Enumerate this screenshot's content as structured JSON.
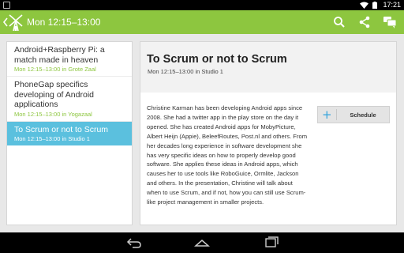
{
  "status_bar": {
    "time": "17:21"
  },
  "action_bar": {
    "title": "Mon 12:15–13:00"
  },
  "sessions": [
    {
      "title": "Android+Raspberry Pi: a match made in heaven",
      "subtitle": "Mon 12:15–13:00 in Grote Zaal",
      "selected": false
    },
    {
      "title": "PhoneGap specifics developing of Android applications",
      "subtitle": "Mon 12:15–13:00 in Yogazaal",
      "selected": false
    },
    {
      "title": "To Scrum or not to Scrum",
      "subtitle": "Mon 12:15–13:00 in Studio 1",
      "selected": true
    }
  ],
  "detail": {
    "title": "To Scrum or not to Scrum",
    "subtitle": "Mon 12:15–13:00 in Studio 1",
    "description": "Christine Karman has been developing Android apps since 2008. She had a twitter app in the play store on the day it opened. She has created Android apps for MobyPicture, Albert Heijn (Appie), BeleefRoutes, Post.nl and others. From her decades long experience in software development she has very specific ideas on how to properly develop good software. She applies these ideas in Android apps, which causes her to use tools like RoboGuice, Ormlite, Jackson and others. In the presentation, Christine will talk about when to use Scrum, and if not, how you can still use Scrum-like project management in smaller projects.",
    "schedule_label": "Schedule",
    "schedule_icon": "+"
  },
  "colors": {
    "action_bar": "#8dc63f",
    "selected": "#5bc0de",
    "accent_text": "#8dc63f",
    "plus": "#33a3dc"
  }
}
